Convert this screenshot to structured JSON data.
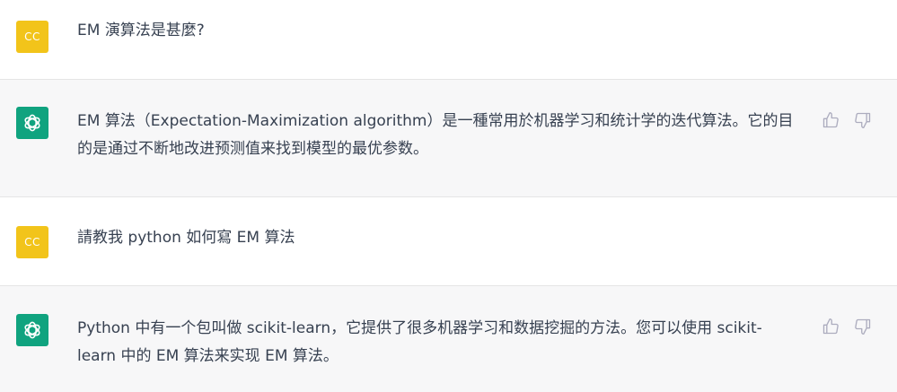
{
  "conversation": [
    {
      "role": "user",
      "avatar_initials": "CC",
      "text": "EM 演算法是甚麼?"
    },
    {
      "role": "assistant",
      "avatar_icon": "openai-logo-icon",
      "text": "EM 算法（Expectation-Maximization algorithm）是一種常用於机器学习和统计学的迭代算法。它的目的是通过不断地改进预测值来找到模型的最优参数。"
    },
    {
      "role": "user",
      "avatar_initials": "CC",
      "text": "請教我 python 如何寫 EM 算法"
    },
    {
      "role": "assistant",
      "avatar_icon": "openai-logo-icon",
      "text": "Python 中有一个包叫做 scikit-learn，它提供了很多机器学习和数据挖掘的方法。您可以使用 scikit-learn 中的 EM 算法来实现 EM 算法。"
    }
  ],
  "actions": {
    "thumbs_up_icon": "thumbs-up-icon",
    "thumbs_down_icon": "thumbs-down-icon"
  },
  "colors": {
    "user_avatar": "#f2c41a",
    "bot_avatar": "#10a37f",
    "assistant_bg": "#f7f7f8",
    "text": "#374151",
    "icon": "#acacbe"
  }
}
